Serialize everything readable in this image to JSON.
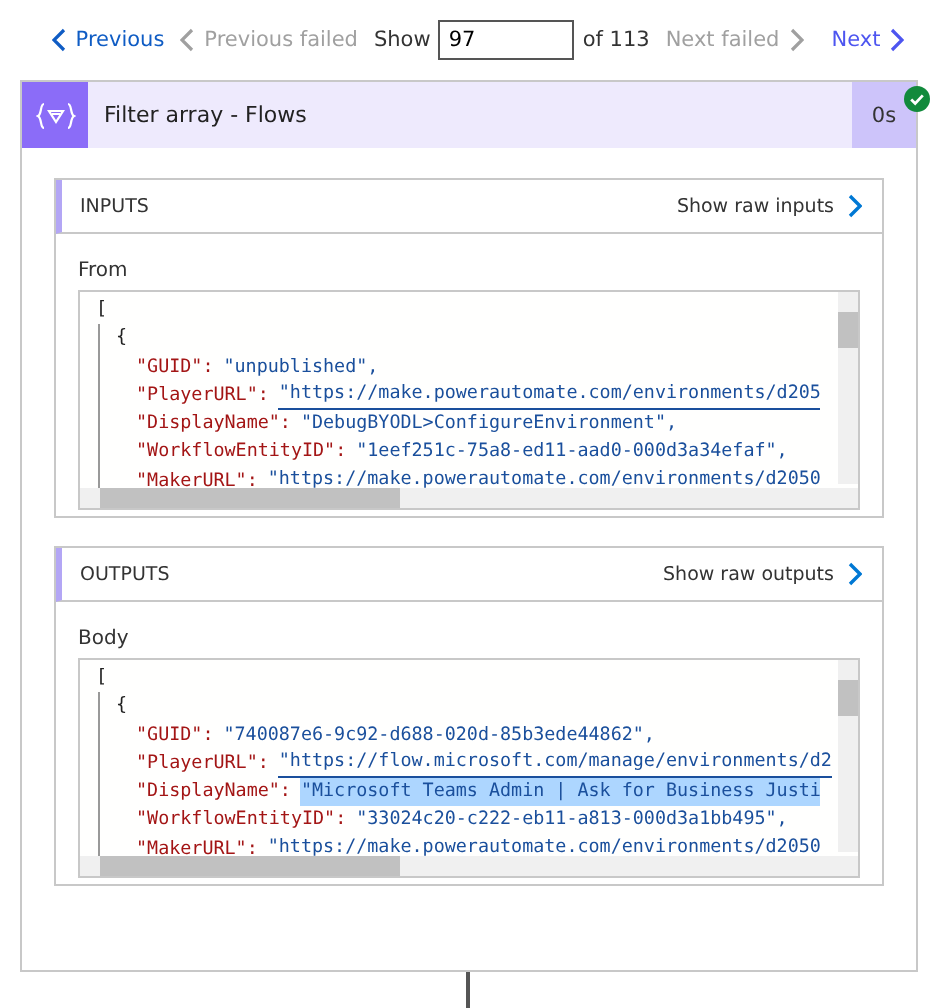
{
  "nav": {
    "previous": {
      "label": "Previous",
      "disabled": false
    },
    "previous_failed": {
      "label": "Previous failed",
      "disabled": true
    },
    "show_label": "Show",
    "show_value": "97",
    "of_label": "of 113",
    "next_failed": {
      "label": "Next failed",
      "disabled": true
    },
    "next": {
      "label": "Next",
      "disabled": false
    }
  },
  "action": {
    "title": "Filter array - Flows",
    "duration": "0s",
    "succeeded": true
  },
  "sections": [
    {
      "title": "INPUTS",
      "raw_link": "Show raw inputs",
      "field_label": "From",
      "code": {
        "open": "[",
        "children": [
          {
            "open": "{",
            "properties": [
              {
                "key": "\"GUID\":",
                "value": "\"unpublished\",",
                "kind": "string",
                "selected": false
              },
              {
                "key": "\"PlayerURL\":",
                "value": "\"https://make.powerautomate.com/environments/d205",
                "kind": "link",
                "selected": false
              },
              {
                "key": "\"DisplayName\":",
                "value": "\"DebugBYODL>ConfigureEnvironment\",",
                "kind": "string",
                "selected": false
              },
              {
                "key": "\"WorkflowEntityID\":",
                "value": "\"1eef251c-75a8-ed11-aad0-000d3a34efaf\",",
                "kind": "string",
                "selected": false
              },
              {
                "key": "\"MakerURL\":",
                "value": "\"https://make.powerautomate.com/environments/d2050",
                "kind": "link",
                "selected": false
              }
            ]
          }
        ]
      }
    },
    {
      "title": "OUTPUTS",
      "raw_link": "Show raw outputs",
      "field_label": "Body",
      "code": {
        "open": "[",
        "children": [
          {
            "open": "{",
            "properties": [
              {
                "key": "\"GUID\":",
                "value": "\"740087e6-9c92-d688-020d-85b3ede44862\",",
                "kind": "string",
                "selected": false
              },
              {
                "key": "\"PlayerURL\":",
                "value": "\"https://flow.microsoft.com/manage/environments/d2",
                "kind": "link",
                "selected": false
              },
              {
                "key": "\"DisplayName\":",
                "value": "\"Microsoft Teams Admin | Ask for Business Justi",
                "kind": "string",
                "selected": true
              },
              {
                "key": "\"WorkflowEntityID\":",
                "value": "\"33024c20-c222-eb11-a813-000d3a1bb495\",",
                "kind": "string",
                "selected": false
              },
              {
                "key": "\"MakerURL\":",
                "value": "\"https://make.powerautomate.com/environments/d2050",
                "kind": "link",
                "selected": false
              }
            ]
          }
        ]
      }
    }
  ]
}
